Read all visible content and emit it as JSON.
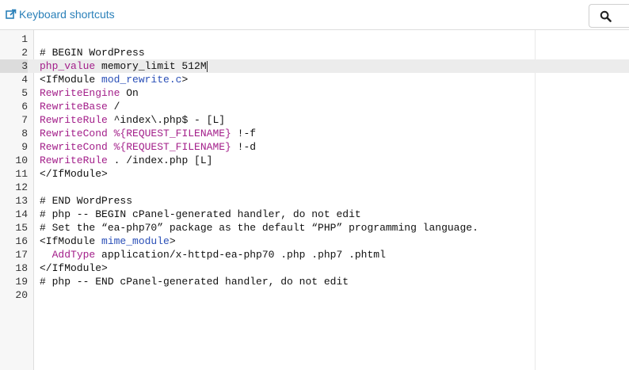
{
  "toolbar": {
    "shortcuts_label": "Keyboard shortcuts",
    "shortcuts_icon": "external-link-icon",
    "search_icon": "search-icon"
  },
  "editor": {
    "lines": [
      {
        "num": "1",
        "tokens": []
      },
      {
        "num": "2",
        "tokens": [
          {
            "t": "# BEGIN WordPress",
            "c": "plain"
          }
        ]
      },
      {
        "num": "3",
        "tokens": [
          {
            "t": "php_value",
            "c": "kw"
          },
          {
            "t": " memory_limit 512M",
            "c": "plain"
          }
        ]
      },
      {
        "num": "4",
        "tokens": [
          {
            "t": "<IfModule ",
            "c": "plain"
          },
          {
            "t": "mod_rewrite.c",
            "c": "attr"
          },
          {
            "t": ">",
            "c": "plain"
          }
        ]
      },
      {
        "num": "5",
        "tokens": [
          {
            "t": "RewriteEngine",
            "c": "kw"
          },
          {
            "t": " On",
            "c": "plain"
          }
        ]
      },
      {
        "num": "6",
        "tokens": [
          {
            "t": "RewriteBase",
            "c": "kw"
          },
          {
            "t": " /",
            "c": "plain"
          }
        ]
      },
      {
        "num": "7",
        "tokens": [
          {
            "t": "RewriteRule",
            "c": "kw"
          },
          {
            "t": " ^index\\.php$ - [L]",
            "c": "plain"
          }
        ]
      },
      {
        "num": "8",
        "tokens": [
          {
            "t": "RewriteCond",
            "c": "kw"
          },
          {
            "t": " %{REQUEST_FILENAME}",
            "c": "var"
          },
          {
            "t": " !-f",
            "c": "plain"
          }
        ]
      },
      {
        "num": "9",
        "tokens": [
          {
            "t": "RewriteCond",
            "c": "kw"
          },
          {
            "t": " %{REQUEST_FILENAME}",
            "c": "var"
          },
          {
            "t": " !-d",
            "c": "plain"
          }
        ]
      },
      {
        "num": "10",
        "tokens": [
          {
            "t": "RewriteRule",
            "c": "kw"
          },
          {
            "t": " . /index.php [L]",
            "c": "plain"
          }
        ]
      },
      {
        "num": "11",
        "tokens": [
          {
            "t": "</IfModule>",
            "c": "plain"
          }
        ]
      },
      {
        "num": "12",
        "tokens": []
      },
      {
        "num": "13",
        "tokens": [
          {
            "t": "# END WordPress",
            "c": "plain"
          }
        ]
      },
      {
        "num": "14",
        "tokens": [
          {
            "t": "# php -- BEGIN cPanel-generated handler, do not edit",
            "c": "plain"
          }
        ]
      },
      {
        "num": "15",
        "tokens": [
          {
            "t": "# Set the “ea-php70” package as the default “PHP” programming language.",
            "c": "plain"
          }
        ]
      },
      {
        "num": "16",
        "tokens": [
          {
            "t": "<IfModule ",
            "c": "plain"
          },
          {
            "t": "mime_module",
            "c": "attr"
          },
          {
            "t": ">",
            "c": "plain"
          }
        ]
      },
      {
        "num": "17",
        "tokens": [
          {
            "t": "  ",
            "c": "plain"
          },
          {
            "t": "AddType",
            "c": "kw"
          },
          {
            "t": " application/x-httpd-ea-php70 .php .php7 .phtml",
            "c": "plain"
          }
        ]
      },
      {
        "num": "18",
        "tokens": [
          {
            "t": "</IfModule>",
            "c": "plain"
          }
        ]
      },
      {
        "num": "19",
        "tokens": [
          {
            "t": "# php -- END cPanel-generated handler, do not edit",
            "c": "plain"
          }
        ]
      },
      {
        "num": "20",
        "tokens": []
      }
    ],
    "active_line": 3
  }
}
